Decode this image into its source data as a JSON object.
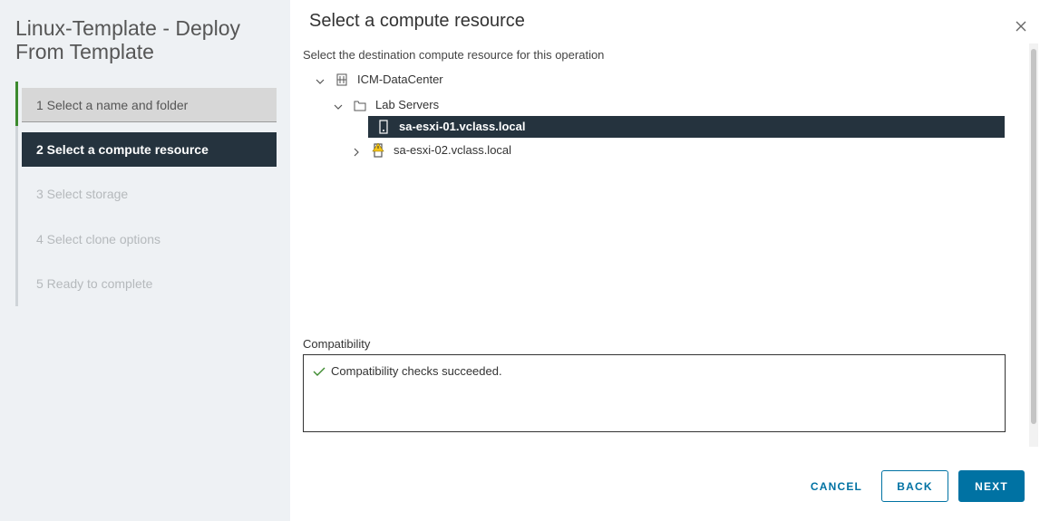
{
  "wizard": {
    "title": "Linux-Template - Deploy From Template",
    "steps": [
      {
        "label": "1  Select a name and folder",
        "state": "done"
      },
      {
        "label": "2  Select a compute resource",
        "state": "active"
      },
      {
        "label": "3  Select storage",
        "state": "pending"
      },
      {
        "label": "4  Select clone options",
        "state": "pending"
      },
      {
        "label": "5  Ready to complete",
        "state": "pending"
      }
    ]
  },
  "main": {
    "title": "Select a compute resource",
    "subtitle": "Select the destination compute resource for this operation",
    "tree": [
      {
        "label": "ICM-DataCenter",
        "icon": "datacenter-icon",
        "expanded": true
      },
      {
        "label": "Lab Servers",
        "icon": "folder-icon",
        "expanded": true
      },
      {
        "label": "sa-esxi-01.vclass.local",
        "icon": "host-icon",
        "selected": true
      },
      {
        "label": "sa-esxi-02.vclass.local",
        "icon": "host-warning-icon",
        "expanded": false
      }
    ],
    "compatibility_label": "Compatibility",
    "compatibility_message": "Compatibility checks succeeded."
  },
  "buttons": {
    "cancel": "CANCEL",
    "back": "BACK",
    "next": "NEXT"
  },
  "colors": {
    "accent": "#0072a3",
    "selected_bg": "#25333e",
    "success": "#3c8a2e",
    "warning": "#f5c518"
  }
}
